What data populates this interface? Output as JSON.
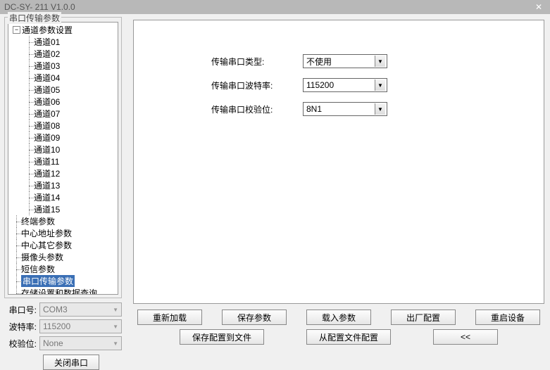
{
  "titlebar": {
    "title": "DC-SY- 211 V1.0.0",
    "close": "✕"
  },
  "sidebar": {
    "fieldset_label": "串口传输参数",
    "tree_root": "通道参数设置",
    "channels": [
      "通道01",
      "通道02",
      "通道03",
      "通道04",
      "通道05",
      "通道06",
      "通道07",
      "通道08",
      "通道09",
      "通道10",
      "通道11",
      "通道12",
      "通道13",
      "通道14",
      "通道15"
    ],
    "items": [
      "终端参数",
      "中心地址参数",
      "中心其它参数",
      "摄像头参数",
      "短信参数",
      "串口传输参数",
      "存储设置和数据查询"
    ],
    "selected_index": 5
  },
  "port_form": {
    "port_label": "串口号:",
    "port_value": "COM3",
    "baud_label": "波特率:",
    "baud_value": "115200",
    "parity_label": "校验位:",
    "parity_value": "None",
    "close_port": "关闭串口"
  },
  "main": {
    "rows": [
      {
        "label": "传输串口类型:",
        "value": "不使用"
      },
      {
        "label": "传输串口波特率:",
        "value": "115200"
      },
      {
        "label": "传输串口校验位:",
        "value": "8N1"
      }
    ]
  },
  "actions": {
    "reload": "重新加载",
    "save_params": "保存参数",
    "load_params": "载入参数",
    "factory": "出厂配置",
    "reboot": "重启设备",
    "save_to_file": "保存配置到文件",
    "from_file": "从配置文件配置",
    "back": "<<"
  }
}
